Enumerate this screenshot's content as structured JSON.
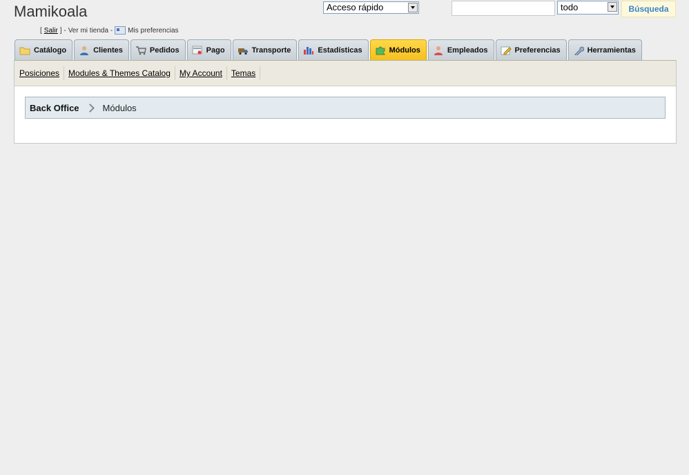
{
  "header": {
    "shop_name": "Mamikoala",
    "logout_prefix": "[",
    "logout_label": "Salir",
    "logout_suffix": "] -",
    "view_shop": "Ver mi tienda -",
    "preferences_label": "Mis preferencias"
  },
  "quick_access": {
    "value": "Acceso rápido"
  },
  "search": {
    "placeholder": "",
    "scope_value": "todo",
    "button_label": "Búsqueda"
  },
  "tabs": [
    {
      "label": "Catálogo",
      "icon": "folder-icon"
    },
    {
      "label": "Clientes",
      "icon": "user-icon"
    },
    {
      "label": "Pedidos",
      "icon": "cart-icon"
    },
    {
      "label": "Pago",
      "icon": "payment-icon"
    },
    {
      "label": "Transporte",
      "icon": "truck-icon"
    },
    {
      "label": "Estadísticas",
      "icon": "bar-chart-icon"
    },
    {
      "label": "Módulos",
      "icon": "puzzle-icon",
      "active": true
    },
    {
      "label": "Empleados",
      "icon": "employee-icon"
    },
    {
      "label": "Preferencias",
      "icon": "preferences-icon"
    },
    {
      "label": "Herramientas",
      "icon": "wrench-icon"
    }
  ],
  "subtabs": [
    "Posiciones",
    "Modules & Themes Catalog",
    "My Account",
    "Temas"
  ],
  "breadcrumb": {
    "root": "Back Office",
    "current": "Módulos"
  },
  "colors": {
    "active_tab": "#f5c020",
    "accent": "#3a83c9"
  }
}
